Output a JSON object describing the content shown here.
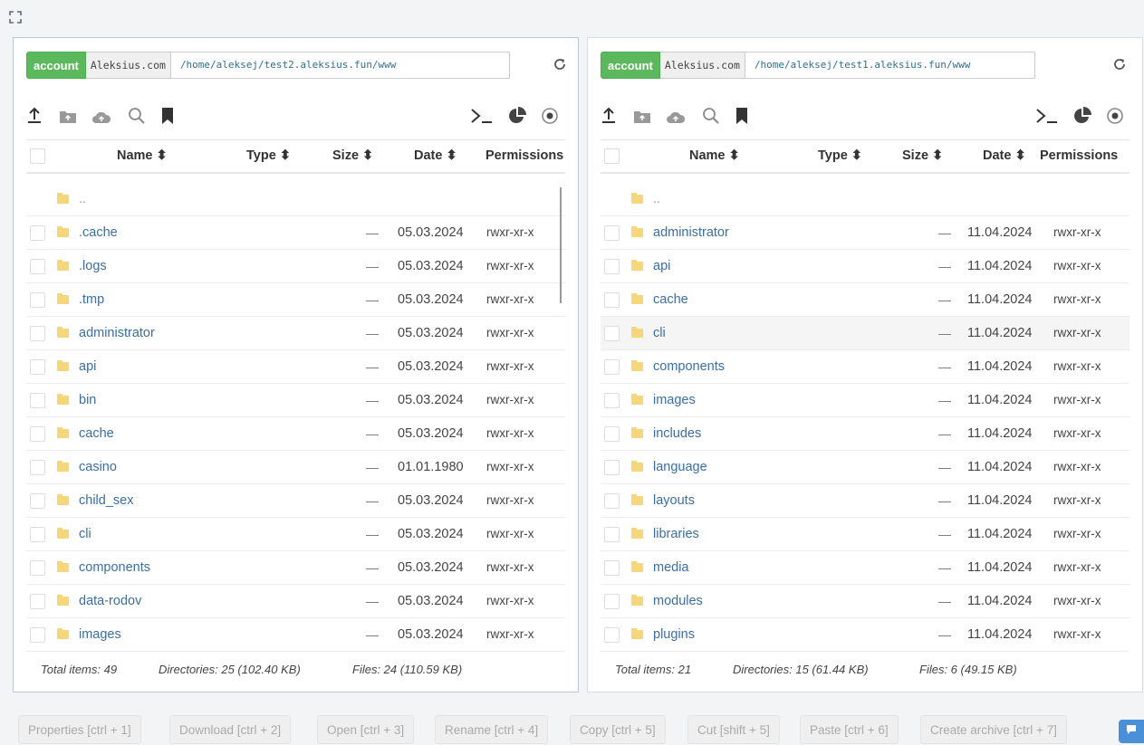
{
  "fullscreen_icon": "fullscreen-icon",
  "left": {
    "account_label": "account",
    "host": "Aleksius.com",
    "path": "/home/aleksej/test2.aleksius.fun/www",
    "columns": {
      "name": "Name ⬍",
      "type": "Type ⬍",
      "size": "Size ⬍",
      "date": "Date ⬍",
      "permissions": "Permissions"
    },
    "up": "..",
    "rows": [
      {
        "name": ".cache",
        "size": "—",
        "date": "05.03.2024",
        "perm": "rwxr-xr-x"
      },
      {
        "name": ".logs",
        "size": "—",
        "date": "05.03.2024",
        "perm": "rwxr-xr-x"
      },
      {
        "name": ".tmp",
        "size": "—",
        "date": "05.03.2024",
        "perm": "rwxr-xr-x"
      },
      {
        "name": "administrator",
        "size": "—",
        "date": "05.03.2024",
        "perm": "rwxr-xr-x"
      },
      {
        "name": "api",
        "size": "—",
        "date": "05.03.2024",
        "perm": "rwxr-xr-x"
      },
      {
        "name": "bin",
        "size": "—",
        "date": "05.03.2024",
        "perm": "rwxr-xr-x"
      },
      {
        "name": "cache",
        "size": "—",
        "date": "05.03.2024",
        "perm": "rwxr-xr-x"
      },
      {
        "name": "casino",
        "size": "—",
        "date": "01.01.1980",
        "perm": "rwxr-xr-x"
      },
      {
        "name": "child_sex",
        "size": "—",
        "date": "05.03.2024",
        "perm": "rwxr-xr-x"
      },
      {
        "name": "cli",
        "size": "—",
        "date": "05.03.2024",
        "perm": "rwxr-xr-x"
      },
      {
        "name": "components",
        "size": "—",
        "date": "05.03.2024",
        "perm": "rwxr-xr-x"
      },
      {
        "name": "data-rodov",
        "size": "—",
        "date": "05.03.2024",
        "perm": "rwxr-xr-x"
      },
      {
        "name": "images",
        "size": "—",
        "date": "05.03.2024",
        "perm": "rwxr-xr-x"
      }
    ],
    "status": {
      "total": "Total items: 49",
      "dirs": "Directories: 25 (102.40 KB)",
      "files": "Files: 24 (110.59 KB)"
    }
  },
  "right": {
    "account_label": "account",
    "host": "Aleksius.com",
    "path": "/home/aleksej/test1.aleksius.fun/www",
    "columns": {
      "name": "Name ⬍",
      "type": "Type ⬍",
      "size": "Size ⬍",
      "date": "Date ⬍",
      "permissions": "Permissions"
    },
    "up": "..",
    "rows": [
      {
        "name": "administrator",
        "size": "—",
        "date": "11.04.2024",
        "perm": "rwxr-xr-x"
      },
      {
        "name": "api",
        "size": "—",
        "date": "11.04.2024",
        "perm": "rwxr-xr-x"
      },
      {
        "name": "cache",
        "size": "—",
        "date": "11.04.2024",
        "perm": "rwxr-xr-x"
      },
      {
        "name": "cli",
        "size": "—",
        "date": "11.04.2024",
        "perm": "rwxr-xr-x"
      },
      {
        "name": "components",
        "size": "—",
        "date": "11.04.2024",
        "perm": "rwxr-xr-x"
      },
      {
        "name": "images",
        "size": "—",
        "date": "11.04.2024",
        "perm": "rwxr-xr-x"
      },
      {
        "name": "includes",
        "size": "—",
        "date": "11.04.2024",
        "perm": "rwxr-xr-x"
      },
      {
        "name": "language",
        "size": "—",
        "date": "11.04.2024",
        "perm": "rwxr-xr-x"
      },
      {
        "name": "layouts",
        "size": "—",
        "date": "11.04.2024",
        "perm": "rwxr-xr-x"
      },
      {
        "name": "libraries",
        "size": "—",
        "date": "11.04.2024",
        "perm": "rwxr-xr-x"
      },
      {
        "name": "media",
        "size": "—",
        "date": "11.04.2024",
        "perm": "rwxr-xr-x"
      },
      {
        "name": "modules",
        "size": "—",
        "date": "11.04.2024",
        "perm": "rwxr-xr-x"
      },
      {
        "name": "plugins",
        "size": "—",
        "date": "11.04.2024",
        "perm": "rwxr-xr-x"
      }
    ],
    "status": {
      "total": "Total items: 21",
      "dirs": "Directories: 15 (61.44 KB)",
      "files": "Files: 6 (49.15 KB)"
    }
  },
  "footer": {
    "buttons": [
      "Properties [ctrl + 1]",
      "Download [ctrl + 2]",
      "Open [ctrl + 3]",
      "Rename [ctrl + 4]",
      "Copy [ctrl + 5]",
      "Cut [shift + 5]",
      "Paste [ctrl + 6]",
      "Create archive [ctrl + 7]"
    ]
  },
  "colors": {
    "account_green": "#5cb85c",
    "link_blue": "#3a6ea5",
    "folder_yellow": "#f6d67a"
  }
}
